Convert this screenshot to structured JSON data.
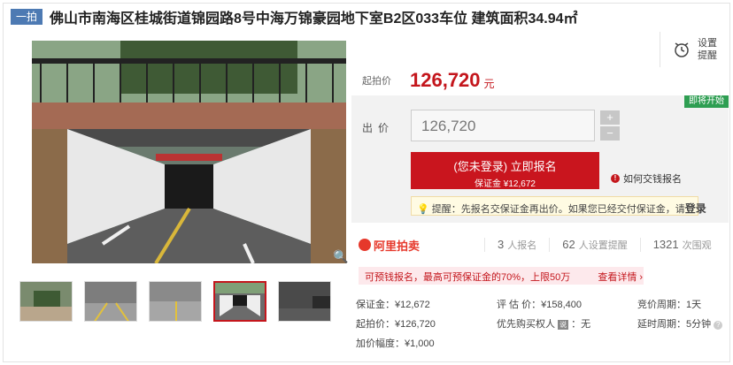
{
  "tag": "一拍",
  "title": "佛山市南海区桂城街道锦园路8号中海万锦豪园地下室B2区033车位 建筑面积34.94㎡",
  "settings": {
    "line1": "设置",
    "line2": "提醒"
  },
  "price": {
    "label": "起拍价",
    "value": "126,720",
    "unit": "元"
  },
  "status_badge": "即将开始",
  "bid": {
    "label": "出价",
    "value": "126,720",
    "plus": "+",
    "minus": "−"
  },
  "signup": {
    "line1": "(您未登录) 立即报名",
    "line2": "保证金 ¥12,672"
  },
  "howto": {
    "icon": "!",
    "text": "如何交钱报名"
  },
  "tip": {
    "prefix": "提醒：先报名交保证金再出价。如果您已经交付保证金，请",
    "link": "登录"
  },
  "brand": "阿里拍卖",
  "stats": [
    {
      "num": "3",
      "label": "人报名"
    },
    {
      "num": "62",
      "label": "人设置提醒"
    },
    {
      "num": "1321",
      "label": "次围观"
    }
  ],
  "loan": {
    "text": "可预钱报名，最高可预保证金的70%，上限50万",
    "link": "查看详情 ›"
  },
  "details": {
    "deposit": "保证金：¥12,672",
    "appraisal": "评 估 价：¥158,400",
    "period": "竞价周期：1天",
    "start": "起拍价：¥126,720",
    "priority": "优先购买权人",
    "priority_badge": "说",
    "priority_val": "：无",
    "delay": "延时周期：5分钟",
    "increment": "加价幅度：¥1,000"
  },
  "colors": {
    "accent": "#c4161c",
    "tag": "#4d7ab3",
    "badge": "#2e9e52"
  }
}
